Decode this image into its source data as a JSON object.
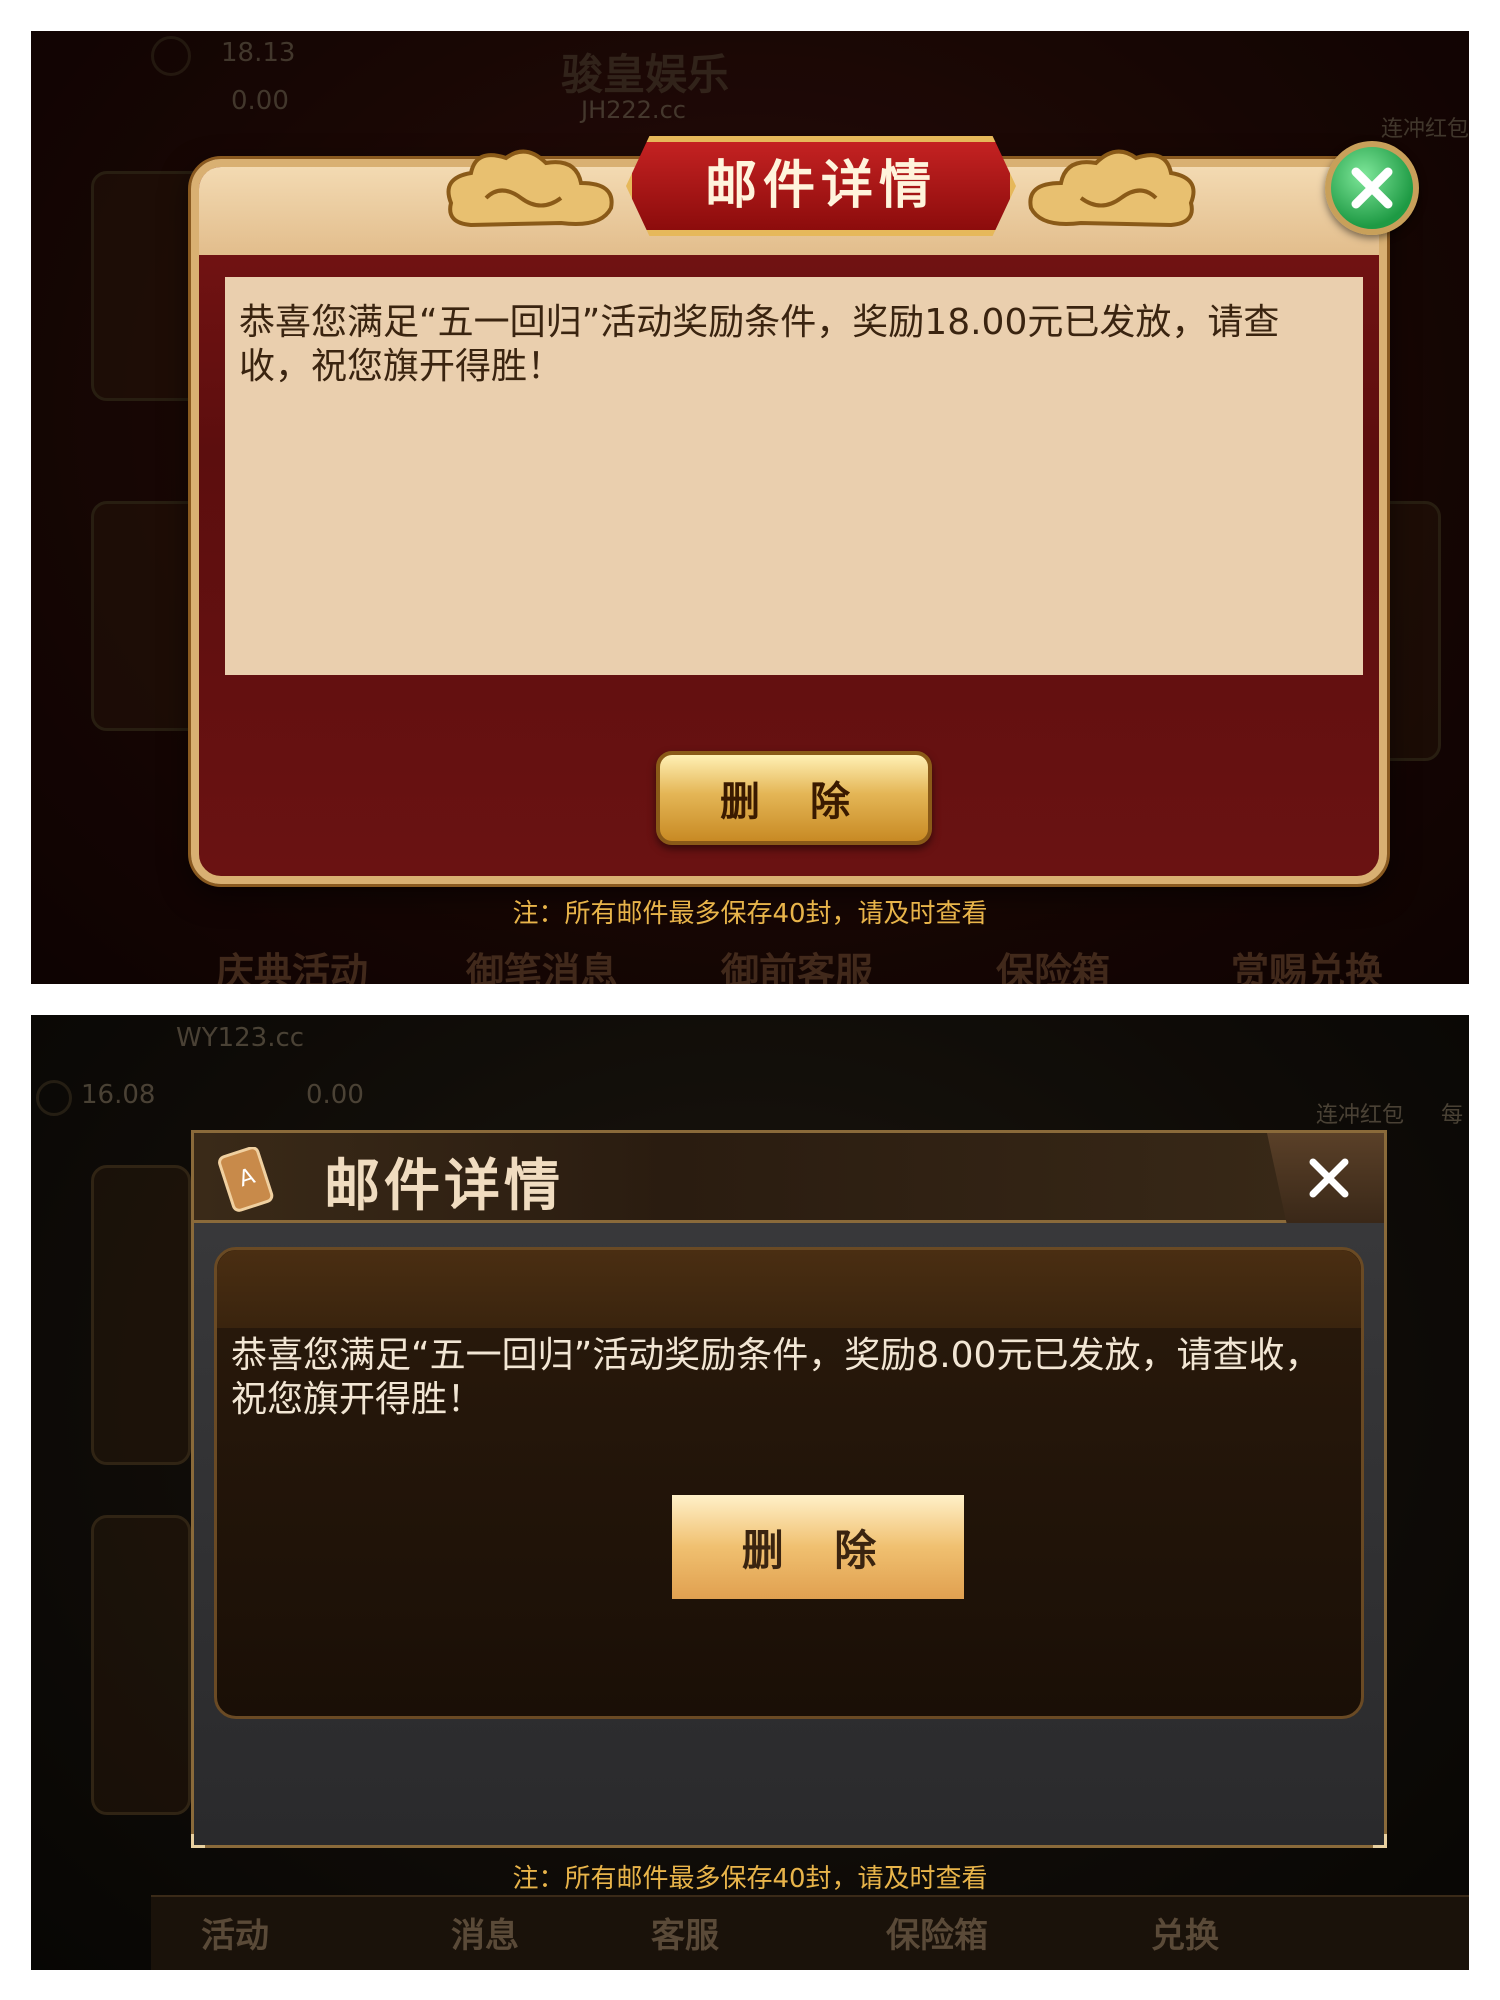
{
  "screenshot1": {
    "top_bar": {
      "coin_balance": "18.13",
      "bank_balance": "0.00",
      "brand_name": "骏皇娱乐",
      "brand_url": "JH222.cc",
      "corner_label": "连冲红包"
    },
    "dialog": {
      "title": "邮件详情",
      "message": "恭喜您满足“五一回归”活动奖励条件，奖励18.00元已发放，请查收，祝您旗开得胜！",
      "delete_label": "删 除"
    },
    "note": "注：所有邮件最多保存40封，请及时查看",
    "bottom_nav": [
      "庆典活动",
      "御笔消息",
      "御前客服",
      "保险箱",
      "赏赐兑换"
    ]
  },
  "screenshot2": {
    "top_bar": {
      "url": "WY123.cc",
      "coin_balance": "16.08",
      "bank_balance": "0.00",
      "corner_label": "连冲红包",
      "corner_label_2": "每"
    },
    "dialog": {
      "title": "邮件详情",
      "message": "恭喜您满足“五一回归”活动奖励条件，奖励8.00元已发放，请查收，祝您旗开得胜！",
      "delete_label": "删 除"
    },
    "note": "注：所有邮件最多保存40封，请及时查看",
    "bottom_nav": [
      "活动",
      "消息",
      "客服",
      "保险箱",
      "兑换"
    ]
  },
  "colors": {
    "accent_gold": "#e8b44a",
    "close_green": "#1e9a44",
    "dialog1_red": "#6a1212",
    "paper": "#eacfae"
  }
}
